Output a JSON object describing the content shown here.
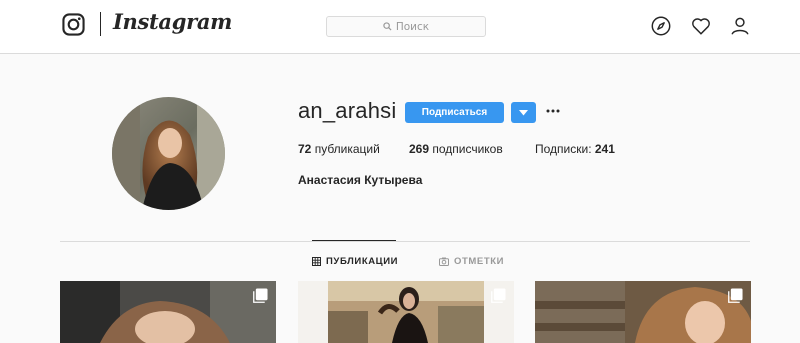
{
  "header": {
    "brand": "Instagram",
    "search": {
      "placeholder": "Поиск"
    },
    "nav_icons": [
      "compass-icon",
      "heart-icon",
      "user-icon"
    ]
  },
  "profile": {
    "username": "an_arahsi",
    "follow_label": "Подписаться",
    "stats": {
      "posts_count": "72",
      "posts_label": " публикаций",
      "followers_count": "269",
      "followers_label": " подписчиков",
      "following_label": "Подписки: ",
      "following_count": "241"
    },
    "full_name": "Анастасия Кутырева"
  },
  "tabs": [
    {
      "label": "ПУБЛИКАЦИИ",
      "icon": "grid-icon",
      "active": true
    },
    {
      "label": "ОТМЕТКИ",
      "icon": "tag-camera-icon",
      "active": false
    }
  ],
  "posts": [
    {
      "type": "carousel",
      "icon": "multiple-posts-icon"
    },
    {
      "type": "carousel",
      "icon": "multiple-posts-icon"
    },
    {
      "type": "carousel",
      "icon": "multiple-posts-icon"
    }
  ],
  "colors": {
    "accent": "#3897f0",
    "text": "#262626",
    "muted": "#999999",
    "border": "#dbdbdb",
    "background": "#fafafa"
  }
}
